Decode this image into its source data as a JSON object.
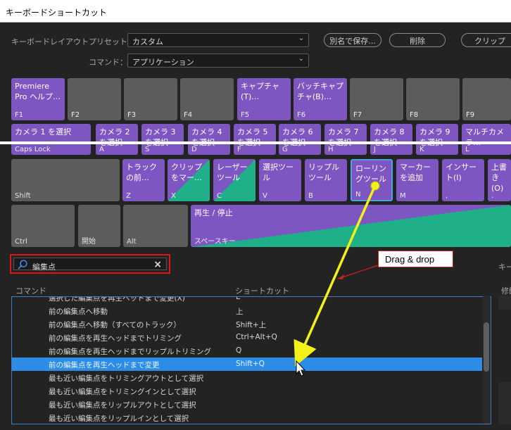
{
  "window": {
    "title": "キーボードショートカット"
  },
  "preset": {
    "label": "キーボードレイアウトプリセット：",
    "value": "カスタム",
    "saveas": "別名で保存...",
    "delete": "削除",
    "clipboard": "クリップ"
  },
  "command": {
    "label": "コマンド：",
    "value": "アプリケーション"
  },
  "keys": {
    "f1": {
      "text": "Premiere Pro ヘルプ…",
      "cap": "F1"
    },
    "f2": {
      "cap": "F2"
    },
    "f3": {
      "cap": "F3"
    },
    "f4": {
      "cap": "F4"
    },
    "f5": {
      "text": "キャプチャ (T)…",
      "cap": "F5"
    },
    "f6": {
      "text": "バッチキャプチャ(B)…",
      "cap": "F6"
    },
    "f7": {
      "cap": "F7"
    },
    "f8": {
      "cap": "F8"
    },
    "f9": {
      "cap": "F9"
    },
    "caps": {
      "text": "カメラ 1 を選択",
      "cap": "Caps Lock"
    },
    "a": {
      "text": "カメラ 2 を選択",
      "cap": "A"
    },
    "s": {
      "text": "カメラ 3 を選択",
      "cap": "S"
    },
    "d": {
      "text": "カメラ 4 を選択",
      "cap": "D"
    },
    "f": {
      "text": "カメラ 5 を選択",
      "cap": "F"
    },
    "g": {
      "text": "カメラ 6 を選択",
      "cap": "G"
    },
    "h": {
      "text": "カメラ 7 を選択",
      "cap": "H"
    },
    "j": {
      "text": "カメラ 8 を選択",
      "cap": "J"
    },
    "k": {
      "text": "カメラ 9 を選択",
      "cap": "K"
    },
    "l": {
      "text": "マルチカメラ…",
      "cap": "L"
    },
    "shift": {
      "cap": "Shift"
    },
    "z": {
      "text": "トラックの前…",
      "cap": "Z"
    },
    "x": {
      "text": "クリップをマー…",
      "cap": "X"
    },
    "c": {
      "text": "レーザーツール",
      "cap": "C"
    },
    "v": {
      "text": "選択ツール",
      "cap": "V"
    },
    "b": {
      "text": "リップルツール",
      "cap": "B"
    },
    "n": {
      "text": "ローリングツール",
      "cap": "N"
    },
    "m": {
      "text": "マーカーを追加",
      "cap": "M"
    },
    "comma": {
      "text": "インサート(I)",
      "cap": ","
    },
    "period": {
      "text": "上書き(O)",
      "cap": "."
    },
    "ctrl": {
      "cap": "Ctrl"
    },
    "alt_open": {
      "cap": "開始"
    },
    "alt": {
      "cap": "Alt"
    },
    "space": {
      "text": "再生 / 停止",
      "cap": "スペースキー"
    }
  },
  "search": {
    "value": "編集点"
  },
  "callout": {
    "text": "Drag & drop"
  },
  "table": {
    "col_command": "コマンド",
    "col_shortcut": "ショートカット",
    "rows": [
      {
        "cmd": "選択した編集点を再生ヘッドまで変更(X)",
        "sc": "E"
      },
      {
        "cmd": "前の編集点へ移動",
        "sc": "上"
      },
      {
        "cmd": "前の編集点へ移動（すべてのトラック）",
        "sc": "Shift+上"
      },
      {
        "cmd": "前の編集点を再生ヘッドまでトリミング",
        "sc": "Ctrl+Alt+Q"
      },
      {
        "cmd": "前の編集点を再生ヘッドまでリップルトリミング",
        "sc": "Q"
      },
      {
        "cmd": "前の編集点を再生ヘッドまで変更",
        "sc": "Shift+Q"
      },
      {
        "cmd": "最も近い編集点をトリミングアウトとして選択",
        "sc": ""
      },
      {
        "cmd": "最も近い編集点をトリミングインとして選択",
        "sc": ""
      },
      {
        "cmd": "最も近い編集点をリップルアウトとして選択",
        "sc": ""
      },
      {
        "cmd": "最も近い編集点をリップルインとして選択",
        "sc": ""
      }
    ],
    "highlight_index": 5
  },
  "right_panel": {
    "head1": "キー",
    "head2": "修飾"
  },
  "colors": {
    "assigned": "#7e56c2",
    "unassigned": "#5c5c5c",
    "multi": "#1fb08a",
    "selection": "#2d8ce6",
    "arrow": "#f2f21a",
    "annotation": "#e0141a"
  }
}
